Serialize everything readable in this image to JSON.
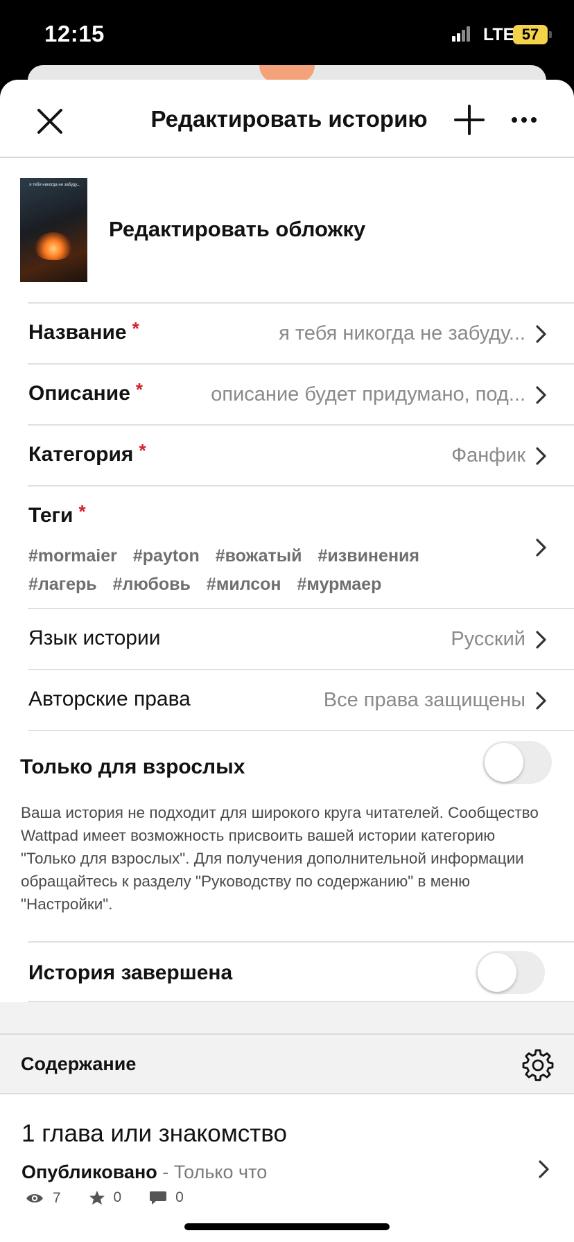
{
  "status_bar": {
    "time": "12:15",
    "network": "LTE",
    "battery": "57"
  },
  "header": {
    "title": "Редактировать историю"
  },
  "cover": {
    "edit_label": "Редактировать обложку",
    "cover_text": "я тебя никогда не забуду..."
  },
  "fields": {
    "title": {
      "label": "Название",
      "required_mark": "*",
      "value": "я тебя никогда не забуду..."
    },
    "description": {
      "label": "Описание",
      "required_mark": "*",
      "value": "описание будет придумано, под..."
    },
    "category": {
      "label": "Категория",
      "required_mark": "*",
      "value": "Фанфик"
    },
    "tags": {
      "label": "Теги",
      "required_mark": "*",
      "items": [
        "#mormaier",
        "#payton",
        "#вожатый",
        "#извинения",
        "#лагерь",
        "#любовь",
        "#милсон",
        "#мурмаер"
      ]
    },
    "language": {
      "label": "Язык истории",
      "value": "Русский"
    },
    "copyright": {
      "label": "Авторские права",
      "value": "Все права защищены"
    }
  },
  "mature": {
    "label": "Только для взрослых",
    "enabled": false,
    "description": "Ваша история не подходит для широкого круга читателей. Сообщество Wattpad имеет возможность присвоить вашей истории категорию \"Только для взрослых\". Для получения дополнительной информации обращайтесь к разделу \"Руководству по содержанию\" в меню \"Настройки\"."
  },
  "completed": {
    "label": "История завершена",
    "enabled": false
  },
  "contents": {
    "title": "Содержание",
    "chapters": [
      {
        "title": "1 глава или знакомство",
        "status": "Опубликовано",
        "separator": " - ",
        "time": "Только что",
        "views": "7",
        "votes": "0",
        "comments": "0"
      }
    ]
  },
  "colors": {
    "required": "#d4212b",
    "battery": "#f4d34a",
    "secondary_text": "#8a8a8a"
  }
}
